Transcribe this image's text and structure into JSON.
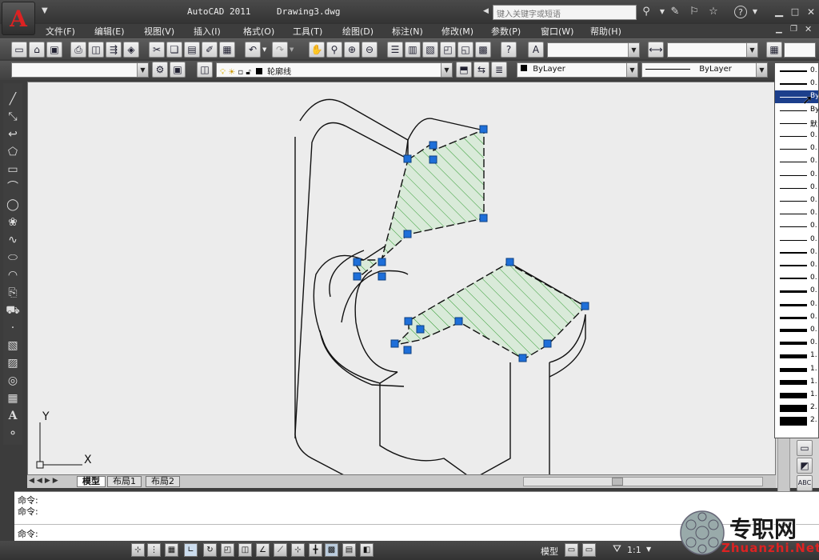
{
  "app": {
    "title": "AutoCAD 2011",
    "document": "Drawing3.dwg",
    "logo_letter": "A",
    "search_placeholder": "键入关键字或短语"
  },
  "menu": [
    "文件(F)",
    "编辑(E)",
    "视图(V)",
    "插入(I)",
    "格式(O)",
    "工具(T)",
    "绘图(D)",
    "标注(N)",
    "修改(M)",
    "参数(P)",
    "窗口(W)",
    "帮助(H)"
  ],
  "layer": {
    "name": "轮廓线",
    "color_label": "ByLayer",
    "linetype_label": "ByLayer"
  },
  "lineweight_list": {
    "items": [
      "0.",
      "0.",
      "By",
      "By",
      "默",
      "0.",
      "0.",
      "0.",
      "0.",
      "0.",
      "0.",
      "0.",
      "0.",
      "0.",
      "0.",
      "0.",
      "0.",
      "0.",
      "0.",
      "0.",
      "0.",
      "0.",
      "1.",
      "1.",
      "1.",
      "1.",
      "2.",
      "2."
    ]
  },
  "tabs": [
    "模型",
    "布局1",
    "布局2"
  ],
  "command": {
    "lines": [
      "命令:",
      "命令:"
    ],
    "prompt": "命令:"
  },
  "status": {
    "space": "模型",
    "scale": "1:1"
  },
  "ucs": {
    "y_label": "Y",
    "x_label": "X"
  },
  "watermark": {
    "cn": "专职网",
    "en": "Zhuanzhi.Net"
  },
  "colors": {
    "grip": "#1e6fd9",
    "hatch": "#2f9a2f",
    "hatch_fill": "#d8ecd8",
    "app_red": "#d22222"
  }
}
